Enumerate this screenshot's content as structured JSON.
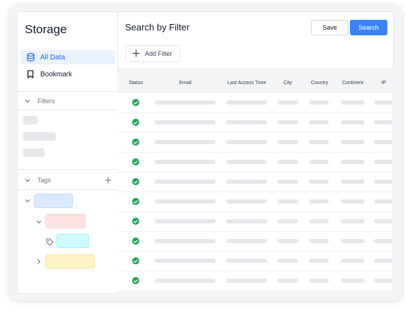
{
  "sidebar": {
    "title": "Storage",
    "nav": [
      {
        "label": "All Data",
        "icon": "database-icon",
        "active": true
      },
      {
        "label": "Bookmark",
        "icon": "bookmark-icon",
        "active": false
      }
    ],
    "filters_label": "Filters",
    "tags_label": "Tags"
  },
  "header": {
    "title": "Search by Filter",
    "save_label": "Save",
    "search_label": "Search",
    "add_filter_label": "Add Filter"
  },
  "table": {
    "columns": [
      "Status",
      "Email",
      "Last Access Time",
      "City",
      "Country",
      "Continent",
      "IP"
    ],
    "row_count": 10,
    "row_status": "ok"
  },
  "colors": {
    "accent": "#3b82f6",
    "active_bg": "#eaf2fd",
    "status_ok": "#22a35a",
    "tag_blue": "#dbeafe",
    "tag_red": "#fee2e2",
    "tag_cyan": "#cffafe",
    "tag_yellow": "#fef3c7"
  }
}
